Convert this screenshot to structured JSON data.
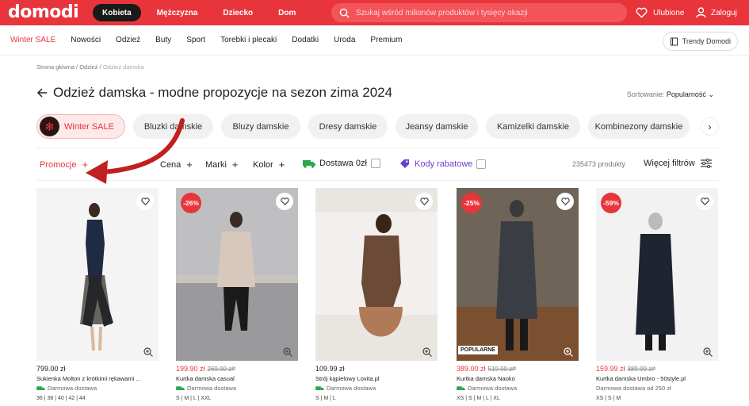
{
  "header": {
    "logo": "domodi",
    "tabs": [
      "Kobieta",
      "Mężczyzna",
      "Dziecko",
      "Dom"
    ],
    "active_tab": 0,
    "search_placeholder": "Szukaj wśród milionów produktów i tysięcy okazji",
    "favorites": "Ulubione",
    "login": "Zaloguj"
  },
  "catnav": {
    "items": [
      "Winter SALE",
      "Nowości",
      "Odzież",
      "Buty",
      "Sport",
      "Torebki i plecaki",
      "Dodatki",
      "Uroda",
      "Premium"
    ],
    "trendy": "Trendy Domodi"
  },
  "breadcrumb": {
    "home": "Strona główna",
    "parent": "Odzież",
    "current": "Odzież damska"
  },
  "page": {
    "title": "Odzież damska - modne propozycje na sezon zima 2024",
    "sort_label": "Sortowanie:",
    "sort_value": "Popularność"
  },
  "chips": [
    "Winter SALE",
    "Bluzki damskie",
    "Bluzy damskie",
    "Dresy damskie",
    "Jeansy damskie",
    "Kamizelki damskie",
    "Kombinezony damskie"
  ],
  "filters": {
    "promo": "Promocje",
    "price": "Cena",
    "brands": "Marki",
    "color": "Kolor",
    "delivery": "Dostawa 0zł",
    "coupons": "Kody rabatowe",
    "count": "235473 produkty",
    "more": "Więcej filtrów"
  },
  "products": [
    {
      "price": "799.00 zł",
      "old": "",
      "discount": "",
      "badge": "",
      "name": "Sukienka Molton z krótkimi rękawami ...",
      "ship": "Darmowa dostawa",
      "sizes": "36 | 38 | 40 | 42 | 44"
    },
    {
      "price": "199.90 zł",
      "old": "269.90 zł*",
      "discount": "-26%",
      "badge": "",
      "name": "Kurtka damska casual",
      "ship": "Darmowa dostawa",
      "sizes": "S | M | L | XXL"
    },
    {
      "price": "109.99 zł",
      "old": "",
      "discount": "",
      "badge": "",
      "name": "Strój kąpielowy Lovita.pl",
      "ship": "Darmowa dostawa",
      "sizes": "S | M | L"
    },
    {
      "price": "389.00 zł",
      "old": "519.00 zł*",
      "discount": "-25%",
      "badge": "POPULARNE",
      "name": "Kurtka damska Naoko",
      "ship": "Darmowa dostawa",
      "sizes": "XS | S | M | L | XL"
    },
    {
      "price": "159.99 zł",
      "old": "389.99 zł*",
      "discount": "-59%",
      "badge": "",
      "name": "Kurtka damska Umbro - 50style.pl",
      "ship": "Darmowa dostawa od 250 zł",
      "sizes": "XS | S | M"
    }
  ],
  "colors": {
    "brand": "#e8353b",
    "delivery_green": "#2aa84a",
    "coupon_purple": "#6a3fd0"
  }
}
